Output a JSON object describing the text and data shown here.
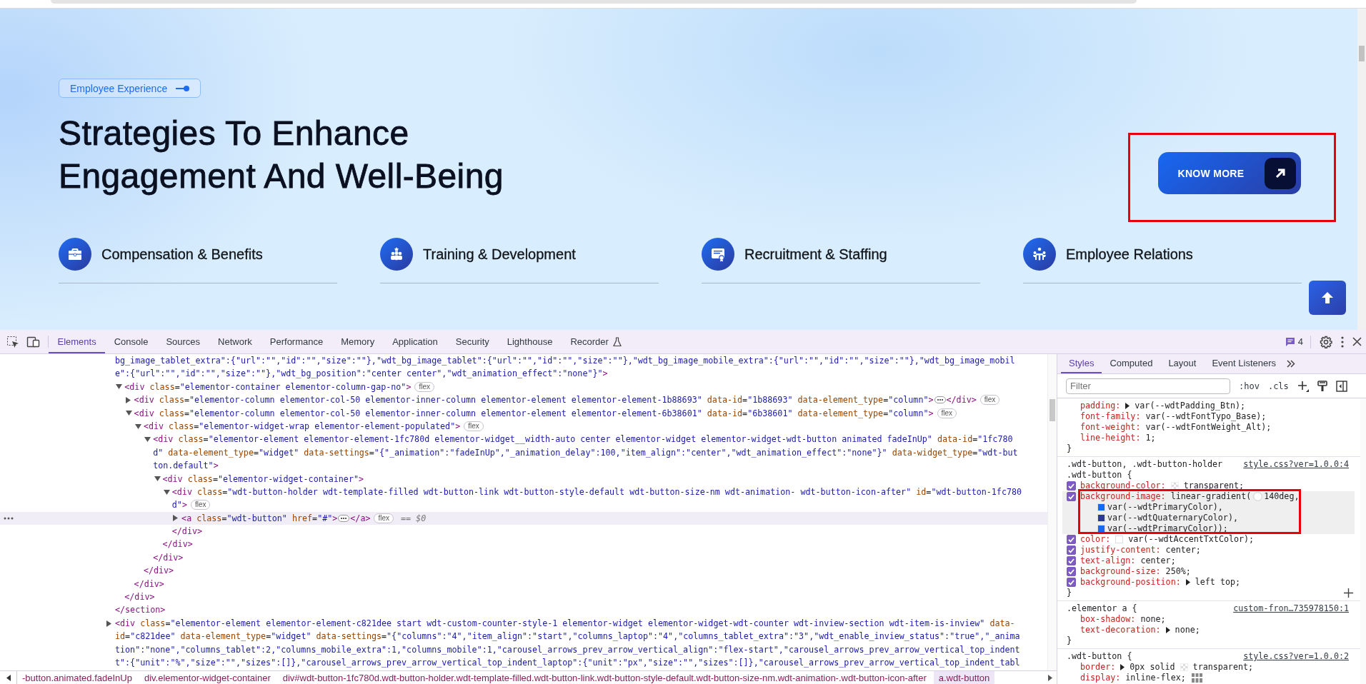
{
  "hero": {
    "tag": "Employee Experience",
    "title": "Strategies To Enhance Engagement And Well-Being",
    "button": {
      "label": "KNOW MORE",
      "annotated": true
    },
    "features": [
      "Compensation & Benefits",
      "Training & Development",
      "Recruitment & Staffing",
      "Employee Relations"
    ]
  },
  "devtools": {
    "tabs": [
      {
        "label": "Elements",
        "selected": true
      },
      {
        "label": "Console",
        "selected": false
      },
      {
        "label": "Sources",
        "selected": false
      },
      {
        "label": "Network",
        "selected": false
      },
      {
        "label": "Performance",
        "selected": false
      },
      {
        "label": "Memory",
        "selected": false
      },
      {
        "label": "Application",
        "selected": false
      },
      {
        "label": "Security",
        "selected": false
      },
      {
        "label": "Lighthouse",
        "selected": false
      },
      {
        "label": "Recorder",
        "selected": false,
        "experimental": true
      }
    ],
    "issues": "4",
    "dom_tree": [
      {
        "selected": false,
        "lines": [
          "bg_image_tablet_extra\":{\"url\":\"\",\"id\":\"\",\"size\":\"\"},\"wdt_bg_image_tablet\":{\"url\":\"\",\"id\":\"\",\"size\":\"\"},\"wdt_bg_image_mobile_extra\":{\"url\":\"\",\"id\":\"\",\"size\":\"\"},\"wdt_bg_image_mobil",
          "e\":{\"url\":\"\",\"id\":\"\",\"size\":\"\"},\"wdt_bg_position\":\"center center\",\"wdt_animation_effect\":\"none\"}\">"
        ],
        "close": "</section>",
        "children": [
          {
            "selected": false,
            "expanded": true,
            "badge": "flex",
            "lines": [
              "<div class=\"elementor-container elementor-column-gap-no\">"
            ],
            "close": "</div>",
            "children": [
              {
                "selected": false,
                "expanded": false,
                "badge": "flex",
                "tail": "</div>",
                "lines": [
                  "<div class=\"elementor-column elementor-col-50 elementor-inner-column elementor-element elementor-element-1b88693\" data-id=\"1b88693\" data-element_type=\"column\">"
                ]
              },
              {
                "selected": false,
                "expanded": true,
                "badge": "flex",
                "lines": [
                  "<div class=\"elementor-column elementor-col-50 elementor-inner-column elementor-element elementor-element-6b38601\" data-id=\"6b38601\" data-element_type=\"column\">"
                ],
                "close": "</div>",
                "children": [
                  {
                    "selected": false,
                    "expanded": true,
                    "badge": "flex",
                    "lines": [
                      "<div class=\"elementor-widget-wrap elementor-element-populated\">"
                    ],
                    "close": "</div>",
                    "children": [
                      {
                        "selected": false,
                        "expanded": true,
                        "lines": [
                          "<div class=\"elementor-element elementor-element-1fc780d elementor-widget__width-auto center elementor-widget elementor-widget-wdt-button animated fadeInUp\" data-id=\"1fc780",
                          "d\" data-element_type=\"widget\" data-settings=\"{\"_animation\":\"fadeInUp\",\"_animation_delay\":100,\"item_align\":\"center\",\"wdt_animation_effect\":\"none\"}\" data-widget_type=\"wdt-but",
                          "ton.default\">"
                        ],
                        "close": "</div>",
                        "children": [
                          {
                            "selected": false,
                            "expanded": true,
                            "lines": [
                              "<div class=\"elementor-widget-container\">"
                            ],
                            "close": "</div>",
                            "children": [
                              {
                                "selected": false,
                                "expanded": true,
                                "badge": "flex",
                                "lines": [
                                  "<div class=\"wdt-button-holder wdt-template-filled wdt-button-link wdt-button-style-default wdt-button-size-nm wdt-animation- wdt-button-icon-after\" id=\"wdt-button-1fc780",
                                  "d\">"
                                ],
                                "close": "</div>",
                                "children": [
                                  {
                                    "selected": true,
                                    "expanded": false,
                                    "badge": "flex",
                                    "tail": "</a>",
                                    "suffix": "== $0",
                                    "lines": [
                                      "<a class=\"wdt-button\" href=\"#\">"
                                    ]
                                  }
                                ]
                              }
                            ]
                          }
                        ]
                      }
                    ]
                  }
                ]
              }
            ]
          }
        ]
      },
      {
        "selected": false,
        "expanded": false,
        "lines": [
          "<div class=\"elementor-element elementor-element-c821dee start wdt-custom-counter-style-1 elementor-widget elementor-widget-wdt-counter wdt-inview-section wdt-item-is-inview\" data-",
          "id=\"c821dee\" data-element_type=\"widget\" data-settings=\"{\"columns\":\"4\",\"item_align\":\"start\",\"columns_laptop\":\"4\",\"columns_tablet_extra\":\"3\",\"wdt_enable_inview_status\":\"true\",\"_anima",
          "tion\":\"none\",\"columns_tablet\":2,\"columns_mobile_extra\":1,\"columns_mobile\":1,\"carousel_arrows_prev_arrow_vertical_align\":\"flex-start\",\"carousel_arrows_prev_arrow_vertical_top_indent",
          "t\":{\"unit\":\"%\",\"size\":\"\",\"sizes\":[]},\"carousel_arrows_prev_arrow_vertical_top_indent_laptop\":{\"unit\":\"px\",\"size\":\"\",\"sizes\":[]},\"carousel_arrows_prev_arrow_vertical_top_indent_tabl"
        ]
      }
    ],
    "breadcrumbs": [
      {
        "label": "-button.animated.fadeInUp",
        "selected": false
      },
      {
        "label": "div.elementor-widget-container",
        "selected": false
      },
      {
        "label": "div#wdt-button-1fc780d.wdt-button-holder.wdt-template-filled.wdt-button-link.wdt-button-style-default.wdt-button-size-nm.wdt-animation-.wdt-button-icon-after",
        "selected": false
      },
      {
        "label": "a.wdt-button",
        "selected": true
      }
    ],
    "styles": {
      "tabs": [
        {
          "label": "Styles",
          "selected": true
        },
        {
          "label": "Computed",
          "selected": false
        },
        {
          "label": "Layout",
          "selected": false
        },
        {
          "label": "Event Listeners",
          "selected": false
        }
      ],
      "filter": {
        "placeholder": "Filter"
      },
      "toggles": [
        ":hov",
        ".cls"
      ],
      "rules": [
        {
          "properties": [
            {
              "name": "padding:",
              "expandable": true,
              "value": "var(--wdtPadding_Btn);"
            },
            {
              "name": "font-family:",
              "value": "var(--wdtFontTypo_Base);"
            },
            {
              "name": "font-weight:",
              "value": "var(--wdtFontWeight_Alt);"
            },
            {
              "name": "line-height:",
              "value": "1;"
            }
          ],
          "close": "}"
        },
        {
          "selector_lines": [
            ".wdt-button, .wdt-button-holder",
            ".wdt-button {"
          ],
          "source": "style.css?ver=1.0.0:4",
          "show_add": true,
          "close": "}",
          "properties": [
            {
              "name": "background-color:",
              "checked": true,
              "swatch": {
                "kind": "checker"
              },
              "value": "transparent;"
            },
            {
              "name": "background-image:",
              "checked": true,
              "highlighted": true,
              "annotated": true,
              "value": "linear-gradient(",
              "angle": "140deg,",
              "sublines": [
                {
                  "swatch": {
                    "kind": "color",
                    "color": "#1a66f5"
                  },
                  "text": "var(--wdtPrimaryColor),"
                },
                {
                  "swatch": {
                    "kind": "color",
                    "color": "#2b3990"
                  },
                  "text": "var(--wdtQuaternaryColor),"
                },
                {
                  "swatch": {
                    "kind": "color",
                    "color": "#1a66f5"
                  },
                  "text": "var(--wdtPrimaryColor));"
                }
              ]
            },
            {
              "name": "color:",
              "checked": true,
              "swatch": {
                "kind": "color",
                "color": "#ffffff"
              },
              "value": "var(--wdtAccentTxtColor);"
            },
            {
              "name": "justify-content:",
              "checked": true,
              "value": "center;"
            },
            {
              "name": "text-align:",
              "checked": true,
              "value": "center;"
            },
            {
              "name": "background-size:",
              "checked": true,
              "value": "250%;"
            },
            {
              "name": "background-position:",
              "checked": true,
              "expandable": true,
              "value": "left top;"
            }
          ]
        },
        {
          "selector_lines": [
            ".elementor a {"
          ],
          "source": "custom-fron…735978150:1",
          "close": "}",
          "properties": [
            {
              "name": "box-shadow:",
              "value": "none;"
            },
            {
              "name": "text-decoration:",
              "expandable": true,
              "value": "none;"
            }
          ]
        },
        {
          "selector_lines": [
            ".wdt-button {"
          ],
          "source": "style.css?ver=1.0.0:2",
          "properties": [
            {
              "name": "border:",
              "expandable": true,
              "prefix": "0px solid",
              "swatch": {
                "kind": "checker"
              },
              "value": "transparent;"
            },
            {
              "name": "display:",
              "value": "inline-flex;",
              "editor_icon": true
            }
          ]
        }
      ]
    }
  }
}
